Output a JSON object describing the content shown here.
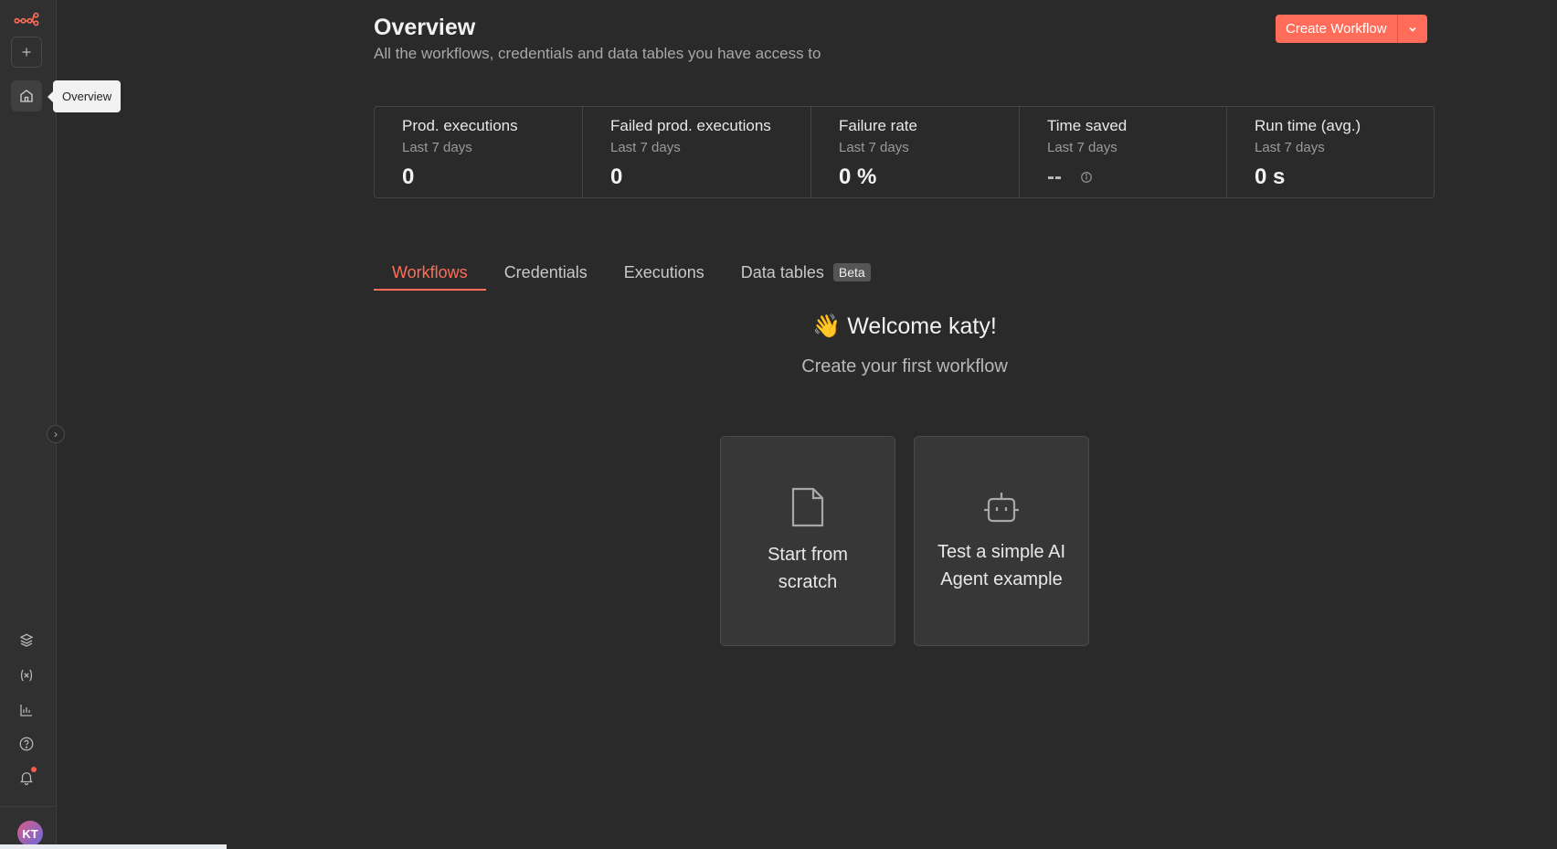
{
  "sidebar": {
    "tooltip": "Overview",
    "avatar_initials": "KT",
    "items": [
      {
        "name": "templates"
      },
      {
        "name": "variables"
      },
      {
        "name": "insights"
      },
      {
        "name": "help"
      },
      {
        "name": "notifications"
      }
    ]
  },
  "header": {
    "title": "Overview",
    "subtitle": "All the workflows, credentials and data tables you have access to",
    "create_label": "Create Workflow"
  },
  "stats": [
    {
      "label": "Prod. executions",
      "period": "Last 7 days",
      "value": "0"
    },
    {
      "label": "Failed prod. executions",
      "period": "Last 7 days",
      "value": "0"
    },
    {
      "label": "Failure rate",
      "period": "Last 7 days",
      "value": "0 %"
    },
    {
      "label": "Time saved",
      "period": "Last 7 days",
      "value": "--"
    },
    {
      "label": "Run time (avg.)",
      "period": "Last 7 days",
      "value": "0 s"
    }
  ],
  "tabs": [
    {
      "label": "Workflows",
      "active": true
    },
    {
      "label": "Credentials"
    },
    {
      "label": "Executions"
    },
    {
      "label": "Data tables",
      "badge": "Beta"
    }
  ],
  "welcome": {
    "title": "👋 Welcome katy!",
    "subtitle": "Create your first workflow"
  },
  "cards": [
    {
      "label": "Start from scratch"
    },
    {
      "label": "Test a simple AI Agent example"
    }
  ],
  "colors": {
    "accent": "#ff6d5a",
    "background": "#2a2a2a"
  }
}
